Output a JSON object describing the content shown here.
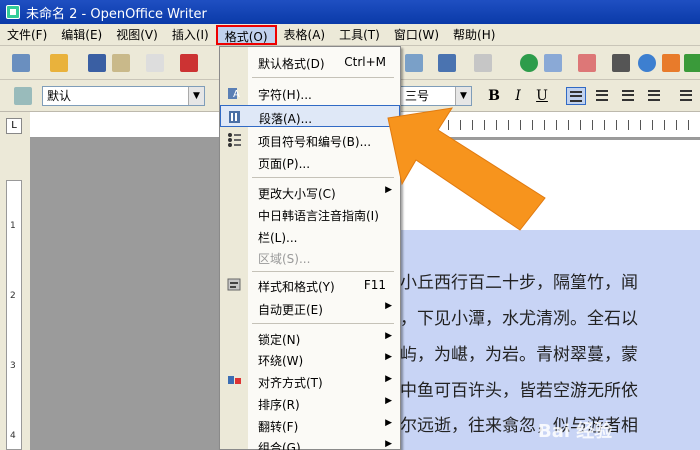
{
  "window": {
    "title": "未命名 2 - OpenOffice Writer"
  },
  "menubar": {
    "items": [
      {
        "label": "文件(F)"
      },
      {
        "label": "编辑(E)"
      },
      {
        "label": "视图(V)"
      },
      {
        "label": "插入(I)"
      },
      {
        "label": "格式(O)"
      },
      {
        "label": "表格(A)"
      },
      {
        "label": "工具(T)"
      },
      {
        "label": "窗口(W)"
      },
      {
        "label": "帮助(H)"
      }
    ],
    "active_index": 4
  },
  "format_toolbar": {
    "paragraph_style": "默认",
    "font_size": "三号",
    "bold": "B",
    "italic": "I",
    "underline": "U"
  },
  "format_menu": {
    "items": [
      {
        "label": "默认格式(D)",
        "shortcut": "Ctrl+M"
      },
      {
        "label": "字符(H)...",
        "icon": "character-icon"
      },
      {
        "label": "段落(A)...",
        "icon": "paragraph-icon",
        "highlighted": true
      },
      {
        "label": "项目符号和编号(B)...",
        "icon": "bullets-icon"
      },
      {
        "label": "页面(P)..."
      },
      {
        "label": "更改大小写(C)",
        "submenu": true
      },
      {
        "label": "中日韩语言注音指南(I)"
      },
      {
        "label": "栏(L)..."
      },
      {
        "label": "区域(S)...",
        "disabled": true
      },
      {
        "label": "样式和格式(Y)",
        "shortcut": "F11",
        "icon": "styles-icon"
      },
      {
        "label": "自动更正(E)",
        "submenu": true
      },
      {
        "label": "锁定(N)",
        "submenu": true
      },
      {
        "label": "环绕(W)",
        "submenu": true
      },
      {
        "label": "对齐方式(T)",
        "submenu": true,
        "icon": "align-icon"
      },
      {
        "label": "排序(R)",
        "submenu": true
      },
      {
        "label": "翻转(F)",
        "submenu": true
      },
      {
        "label": "组合(G)",
        "submenu": true
      }
    ]
  },
  "document": {
    "lines": [
      "小丘西行百二十步，隔篁竹，闻",
      "，下见小潭，水尤清冽。全石以",
      "屿，为嵁，为岩。青树翠蔓，蒙",
      "中鱼可百许头，皆若空游无所依",
      "尔远逝，往来翕忽，似与游者相"
    ]
  },
  "ruler": {
    "vertical_labels": [
      "1",
      "2",
      "3",
      "4"
    ]
  },
  "watermark": {
    "text": "Bai 经验"
  },
  "colors": {
    "arrow": "#f7941d",
    "highlight": "#316ac5",
    "titlebar": "#0a3aa8"
  }
}
